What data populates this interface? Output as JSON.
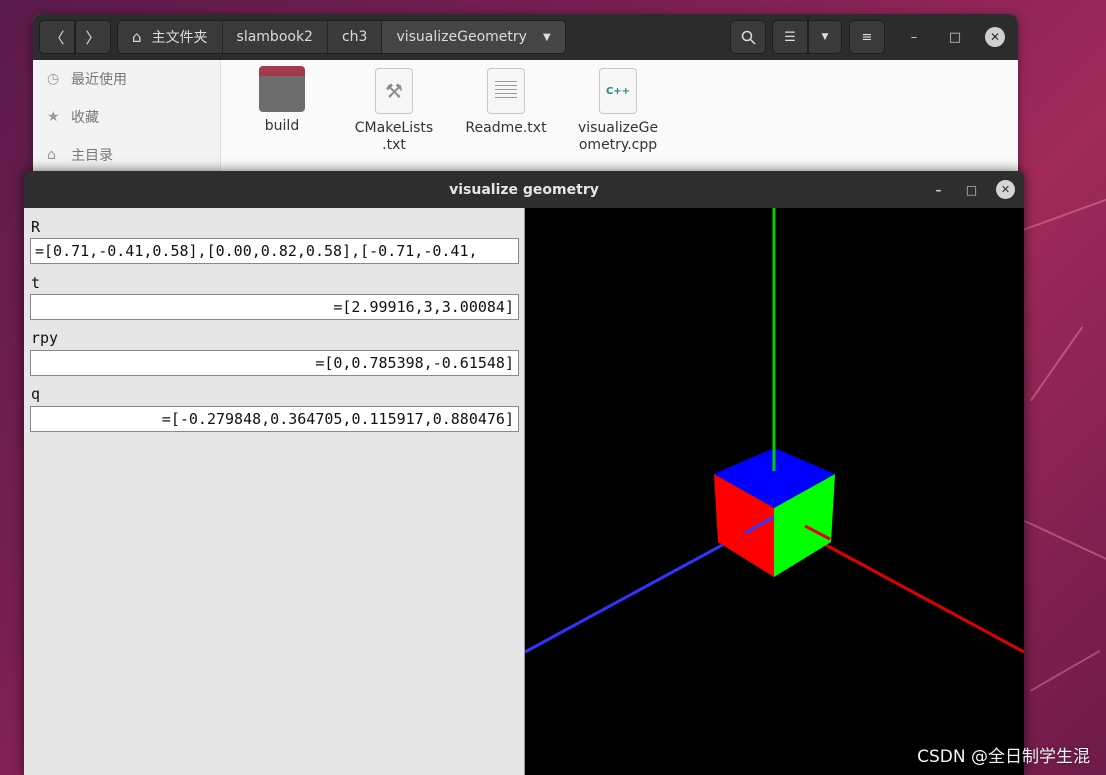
{
  "file_manager": {
    "breadcrumbs": [
      "主文件夹",
      "slambook2",
      "ch3",
      "visualizeGeometry"
    ],
    "sidebar": [
      {
        "label": "最近使用",
        "icon": "clock-icon"
      },
      {
        "label": "收藏",
        "icon": "star-icon"
      },
      {
        "label": "主目录",
        "icon": "home-icon"
      }
    ],
    "files": [
      {
        "name": "build",
        "type": "folder"
      },
      {
        "name": "CMakeLists\n.txt",
        "type": "cmake"
      },
      {
        "name": "Readme.txt",
        "type": "text"
      },
      {
        "name": "visualizeGe\nometry.cpp",
        "type": "cpp"
      }
    ],
    "cpp_badge": "C++"
  },
  "viz": {
    "title": "visualize geometry",
    "vars": [
      {
        "label": "R",
        "value": "=[0.71,-0.41,0.58],[0.00,0.82,0.58],[-0.71,-0.41,"
      },
      {
        "label": "t",
        "value": "=[2.99916,3,3.00084]"
      },
      {
        "label": "rpy",
        "value": "=[0,0.785398,-0.61548]"
      },
      {
        "label": "q",
        "value": "=[-0.279848,0.364705,0.115917,0.880476]"
      }
    ],
    "axis_colors": {
      "x": "#e00000",
      "y": "#00cc00",
      "z": "#3333ff"
    },
    "cube_colors": {
      "top": "#0000ff",
      "left": "#ff0000",
      "right": "#00ff00"
    }
  },
  "watermark": "CSDN @全日制学生混"
}
